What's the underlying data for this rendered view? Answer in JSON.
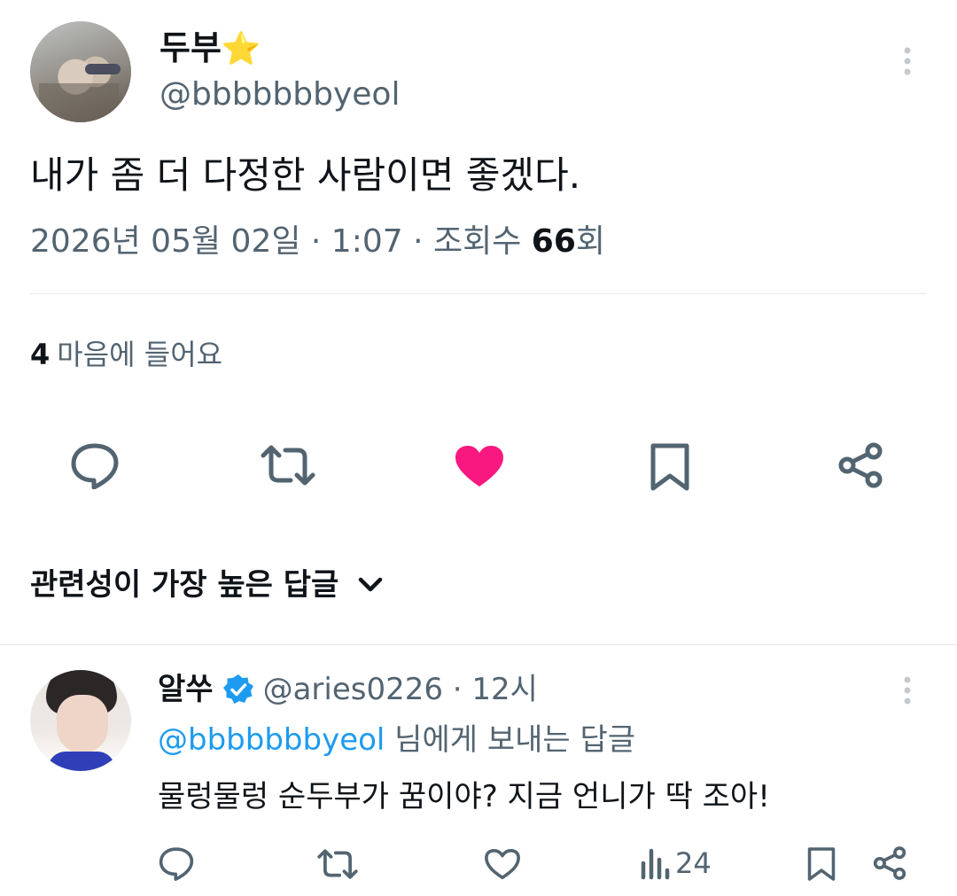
{
  "post": {
    "display_name": "두부",
    "name_emoji": "⭐",
    "handle": "@bbbbbbbyeol",
    "text": "내가 좀 더 다정한 사람이면 좋겠다.",
    "meta_date": "2026년 05월 02일 · 1:07 · 조회수 ",
    "views": "66",
    "views_suffix": "회",
    "likes_count": "4",
    "likes_label": "마음에 들어요"
  },
  "actions": {
    "icons": [
      "reply-icon",
      "retweet-icon",
      "like-icon",
      "bookmark-icon",
      "share-icon"
    ],
    "like_color": "#f91880"
  },
  "replies_sort": {
    "label": "관련성이 가장 높은 답글"
  },
  "reply": {
    "display_name": "알쑤",
    "handle_time": "@aries0226 · 12시",
    "to_handle": "@bbbbbbbyeol",
    "to_suffix": " 님에게 보내는 답글",
    "text": "물렁물렁 순두부가 꿈이야? 지금 언니가 딱 조아!",
    "views": "24",
    "verified_color": "#1d9bf0"
  }
}
